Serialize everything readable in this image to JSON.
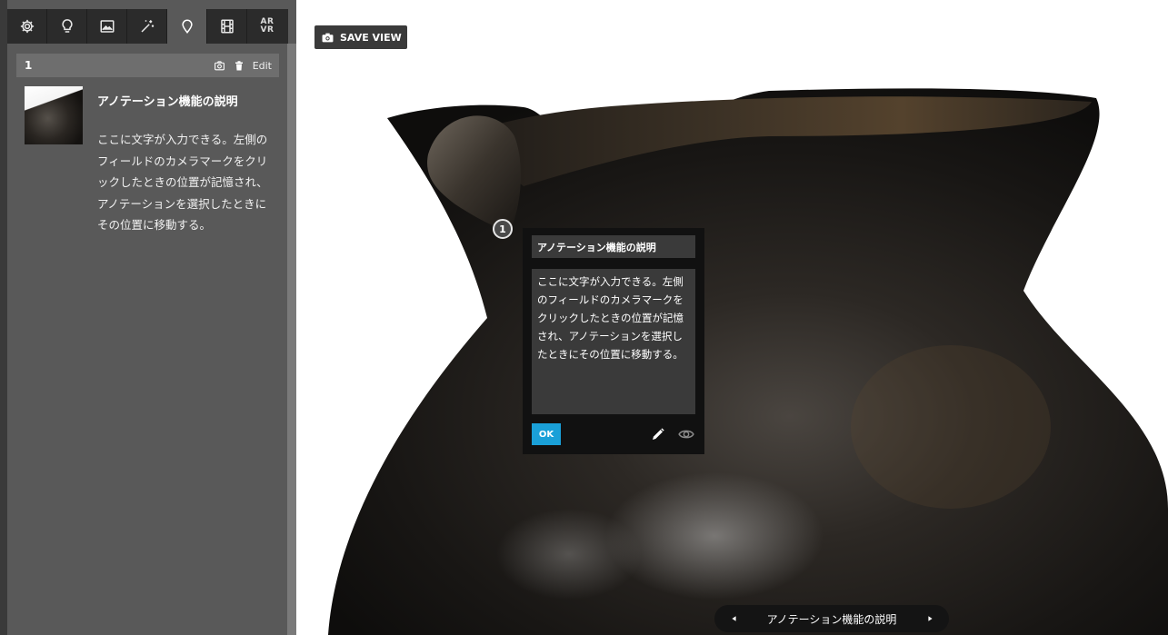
{
  "sidebar": {
    "tabs": [
      {
        "name": "settings-icon"
      },
      {
        "name": "lightbulb-icon"
      },
      {
        "name": "image-icon"
      },
      {
        "name": "magic-wand-icon"
      },
      {
        "name": "map-pin-icon",
        "active": true
      },
      {
        "name": "film-icon"
      },
      {
        "name": "ar-vr-icon",
        "label": "AR\nVR"
      }
    ],
    "annotation": {
      "number": "1",
      "edit_label": "Edit",
      "title": "アノテーション機能の説明",
      "description": "ここに文字が入力できる。左側のフィールドのカメラマークをクリックしたときの位置が記憶され、アノテーションを選択したときにその位置に移動する。"
    }
  },
  "viewer": {
    "save_view_label": "SAVE VIEW",
    "marker_number": "1",
    "popup": {
      "title": "アノテーション機能の説明",
      "body": "ここに文字が入力できる。左側のフィールドのカメラマークをクリックしたときの位置が記憶され、アノテーションを選択したときにその位置に移動する。",
      "ok_label": "OK"
    },
    "nav": {
      "label": "アノテーション機能の説明"
    }
  },
  "colors": {
    "sidebar_bg": "#595959",
    "tabbar_bg": "#2b2b2b",
    "ok_button": "#1aa0d8",
    "popup_bg": "#111111"
  }
}
